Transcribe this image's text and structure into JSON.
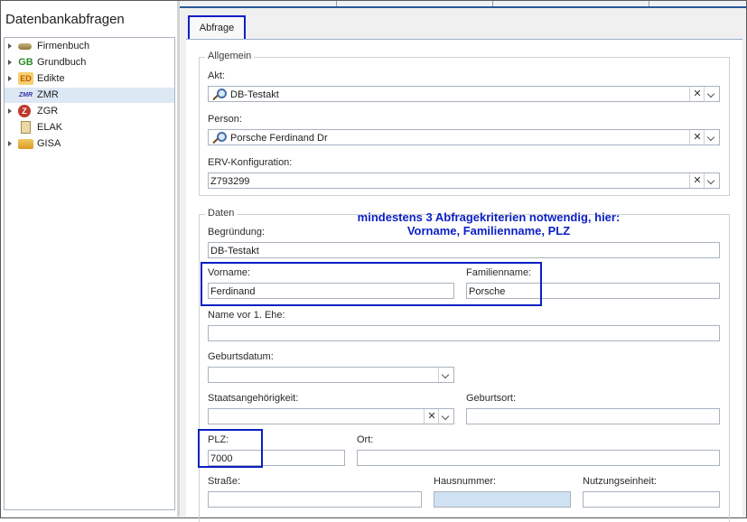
{
  "left_panel": {
    "title": "Datenbankabfragen",
    "items": [
      {
        "label": "Firmenbuch",
        "icon": "firmenbuch-icon"
      },
      {
        "label": "Grundbuch",
        "icon": "grundbuch-icon",
        "icon_text": "GB"
      },
      {
        "label": "Edikte",
        "icon": "edikte-icon",
        "icon_text": "ED"
      },
      {
        "label": "ZMR",
        "icon": "zmr-icon",
        "icon_text": "ZMR"
      },
      {
        "label": "ZGR",
        "icon": "zgr-icon",
        "icon_text": "Z"
      },
      {
        "label": "ELAK",
        "icon": "elak-icon"
      },
      {
        "label": "GISA",
        "icon": "gisa-icon"
      }
    ]
  },
  "tab": {
    "label": "Abfrage"
  },
  "allgemein": {
    "legend": "Allgemein",
    "akt": {
      "label": "Akt:",
      "value": "DB-Testakt"
    },
    "person": {
      "label": "Person:",
      "value": "Porsche Ferdinand Dr"
    },
    "erv": {
      "label": "ERV-Konfiguration:",
      "value": "Z793299"
    },
    "clear_glyph": "✕"
  },
  "daten": {
    "legend": "Daten",
    "annotation_line1": "mindestens 3 Abfragekriterien notwendig, hier:",
    "annotation_line2": "Vorname, Familienname, PLZ",
    "begruendung": {
      "label": "Begründung:",
      "value": "DB-Testakt"
    },
    "vorname": {
      "label": "Vorname:",
      "value": "Ferdinand"
    },
    "familienname": {
      "label": "Familienname:",
      "value": "Porsche"
    },
    "name_vor_ehe": {
      "label": "Name vor 1. Ehe:",
      "value": ""
    },
    "geburtsdatum": {
      "label": "Geburtsdatum:",
      "value": ""
    },
    "staatsangehoerigkeit": {
      "label": "Staatsangehörigkeit:",
      "value": ""
    },
    "geburtsort": {
      "label": "Geburtsort:",
      "value": ""
    },
    "plz": {
      "label": "PLZ:",
      "value": "7000"
    },
    "ort": {
      "label": "Ort:",
      "value": ""
    },
    "strasse": {
      "label": "Straße:",
      "value": ""
    },
    "hausnummer": {
      "label": "Hausnummer:",
      "value": ""
    },
    "nutzungseinheit": {
      "label": "Nutzungseinheit:",
      "value": ""
    }
  },
  "colors": {
    "highlight": "#0a1fc4",
    "selection": "#dde8f5",
    "focused_field": "#cfe2f4"
  }
}
